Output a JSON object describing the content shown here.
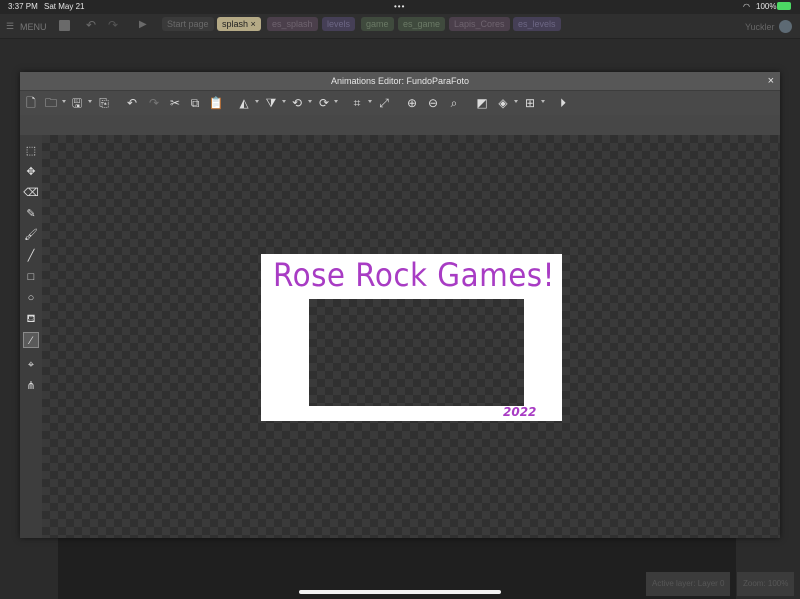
{
  "status_bar": {
    "time": "3:37 PM",
    "date": "Sat May 21",
    "battery": "100%"
  },
  "app_bar": {
    "menu_label": "MENU",
    "user": "Yuckler",
    "tabs": [
      {
        "label": "Start page",
        "style": "plain"
      },
      {
        "label": "splash",
        "style": "active"
      },
      {
        "label": "es_splash",
        "style": "pink"
      },
      {
        "label": "levels",
        "style": "purple"
      },
      {
        "label": "game",
        "style": "green"
      },
      {
        "label": "es_game",
        "style": "green"
      },
      {
        "label": "Lapis_Cores",
        "style": "pink"
      },
      {
        "label": "es_levels",
        "style": "purple"
      }
    ]
  },
  "editor": {
    "title": "Animations Editor: FundoParaFoto",
    "close_glyph": "×"
  },
  "sprite": {
    "title_text": "Rose Rock Games!",
    "year_text": "2022",
    "ink_color": "#a83cc4"
  },
  "bottom": {
    "active_layer": "Active layer: Layer 0",
    "zoom": "Zoom: 100%"
  }
}
